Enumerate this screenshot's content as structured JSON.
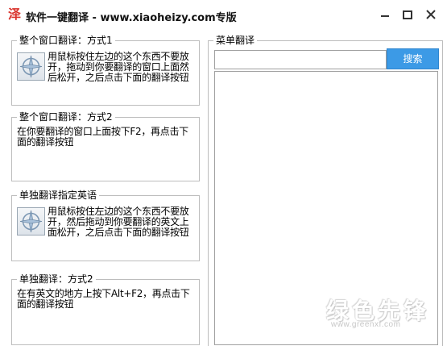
{
  "window": {
    "icon_glyph": "泽",
    "title": "软件一键翻译 - www.xiaoheizy.com专版",
    "controls": [
      "minimize-icon",
      "maximize-icon",
      "close-icon"
    ]
  },
  "groups": [
    {
      "label": "整个窗口翻译：方式1",
      "has_drag_icon": true,
      "text": "用鼠标按住左边的这个东西不要放开，拖动到你要翻译的窗口上面然后松开，之后点击下面的翻译按钮"
    },
    {
      "label": "整个窗口翻译：方式2",
      "has_drag_icon": false,
      "text": "在你要翻译的窗口上面按下F2，再点击下面的翻译按钮"
    },
    {
      "label": "单独翻译指定英语",
      "has_drag_icon": true,
      "text": "用鼠标按住左边的这个东西不要放开，然后拖动到你要翻译的英文上面松开，之后点击下面的翻译按钮"
    },
    {
      "label": "单独翻译：方式2",
      "has_drag_icon": false,
      "text": "在有英文的地方上按下Alt+F2，再点击下面的翻译按钮"
    }
  ],
  "menu_panel": {
    "label": "菜单翻译",
    "search_value": "",
    "search_button": "搜索"
  },
  "watermark": {
    "text": "绿色先锋",
    "url": "www.greenxf.com"
  },
  "colors": {
    "accent": "#3c9ae6",
    "icon_red": "#d9322b",
    "border": "#bdbdbd"
  }
}
